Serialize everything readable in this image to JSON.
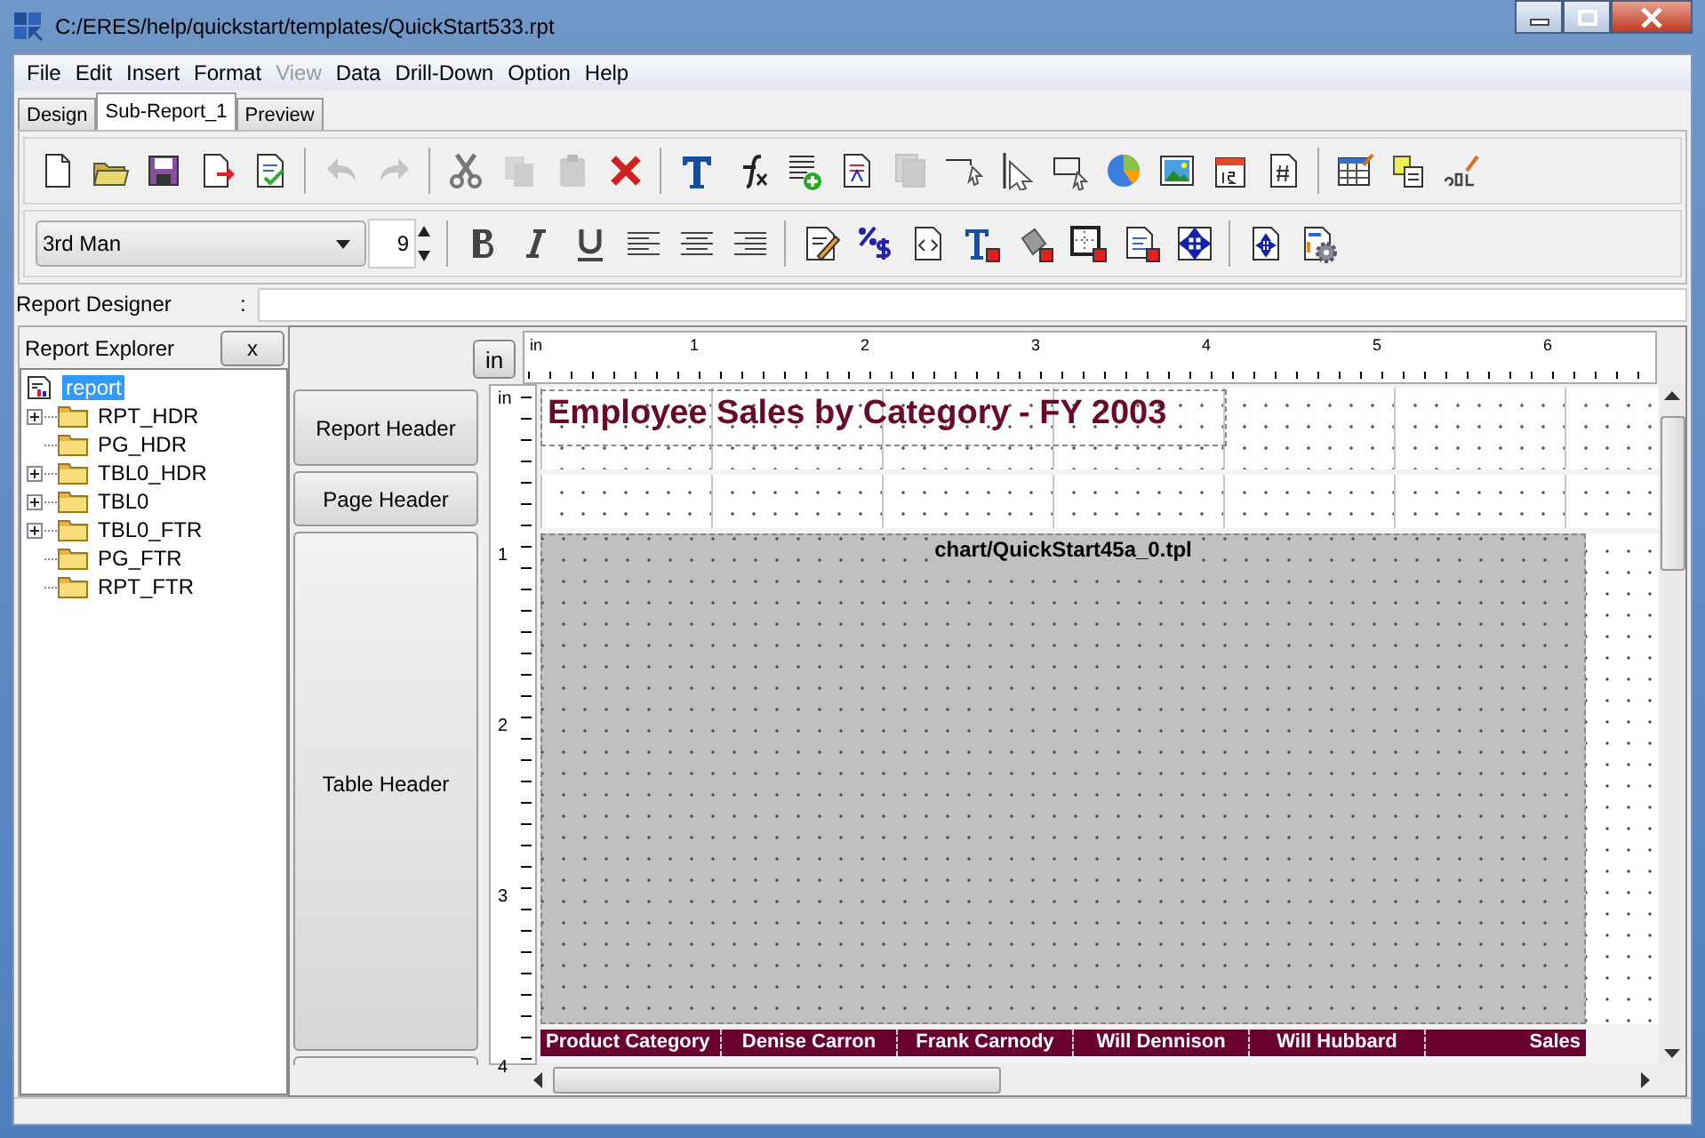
{
  "window": {
    "title": "C:/ERES/help/quickstart/templates/QuickStart533.rpt"
  },
  "menu": [
    {
      "label": "File",
      "disabled": false
    },
    {
      "label": "Edit",
      "disabled": false
    },
    {
      "label": "Insert",
      "disabled": false
    },
    {
      "label": "Format",
      "disabled": false
    },
    {
      "label": "View",
      "disabled": true
    },
    {
      "label": "Data",
      "disabled": false
    },
    {
      "label": "Drill-Down",
      "disabled": false
    },
    {
      "label": "Option",
      "disabled": false
    },
    {
      "label": "Help",
      "disabled": false
    }
  ],
  "tabs": [
    {
      "label": "Design",
      "selected": false
    },
    {
      "label": "Sub-Report_1",
      "selected": true
    },
    {
      "label": "Preview",
      "selected": false
    }
  ],
  "toolbar_1": [
    [
      {
        "kind": "new",
        "disabled": false
      },
      {
        "kind": "open",
        "disabled": false
      },
      {
        "kind": "save",
        "disabled": false
      },
      {
        "kind": "export",
        "disabled": false
      },
      {
        "kind": "validate",
        "disabled": false
      }
    ],
    [
      {
        "kind": "undo",
        "disabled": true
      },
      {
        "kind": "redo",
        "disabled": true
      }
    ],
    [
      {
        "kind": "cut",
        "disabled": false
      },
      {
        "kind": "copy",
        "disabled": true
      },
      {
        "kind": "paste",
        "disabled": true
      },
      {
        "kind": "delete",
        "disabled": false
      }
    ],
    [
      {
        "kind": "text",
        "disabled": false
      },
      {
        "kind": "formula",
        "disabled": false
      },
      {
        "kind": "add-field",
        "disabled": false
      },
      {
        "kind": "label",
        "disabled": false
      },
      {
        "kind": "subreport",
        "disabled": true
      },
      {
        "kind": "line",
        "disabled": false
      },
      {
        "kind": "vline",
        "disabled": false
      },
      {
        "kind": "rect",
        "disabled": false
      },
      {
        "kind": "chart",
        "disabled": false
      },
      {
        "kind": "image",
        "disabled": false
      },
      {
        "kind": "date",
        "disabled": false
      },
      {
        "kind": "page-number",
        "disabled": false
      }
    ],
    [
      {
        "kind": "table",
        "disabled": false
      },
      {
        "kind": "database",
        "disabled": false
      },
      {
        "kind": "sql",
        "disabled": false
      }
    ]
  ],
  "font": {
    "name": "3rd Man",
    "size": "9"
  },
  "toolbar_2": [
    [
      {
        "kind": "bold",
        "disabled": false
      },
      {
        "kind": "italic",
        "disabled": false
      },
      {
        "kind": "underline",
        "disabled": false
      },
      {
        "kind": "align-left",
        "disabled": false
      },
      {
        "kind": "align-center",
        "disabled": false
      },
      {
        "kind": "align-right",
        "disabled": false
      }
    ],
    [
      {
        "kind": "edit",
        "disabled": false
      },
      {
        "kind": "percent",
        "disabled": false
      },
      {
        "kind": "html",
        "disabled": false
      },
      {
        "kind": "text-color",
        "disabled": false
      },
      {
        "kind": "fill",
        "disabled": false
      },
      {
        "kind": "border",
        "disabled": false
      },
      {
        "kind": "doc-color",
        "disabled": false
      },
      {
        "kind": "move",
        "disabled": false
      }
    ],
    [
      {
        "kind": "fit",
        "disabled": false
      },
      {
        "kind": "settings",
        "disabled": false
      }
    ]
  ],
  "designer_field": {
    "label": "Report Designer",
    "separator": ":"
  },
  "explorer": {
    "title": "Report Explorer",
    "close": "x",
    "tree": {
      "label": "report",
      "selected": true,
      "children": [
        {
          "label": "RPT_HDR",
          "expandable": true,
          "selected": false
        },
        {
          "label": "PG_HDR",
          "expandable": false,
          "selected": false
        },
        {
          "label": "TBL0_HDR",
          "expandable": true,
          "selected": false
        },
        {
          "label": "TBL0",
          "expandable": true,
          "selected": false
        },
        {
          "label": "TBL0_FTR",
          "expandable": true,
          "selected": false
        },
        {
          "label": "PG_FTR",
          "expandable": false,
          "selected": false
        },
        {
          "label": "RPT_FTR",
          "expandable": false,
          "selected": false
        }
      ]
    }
  },
  "unit_button": "in",
  "h_ruler": [
    "in",
    "1",
    "2",
    "3",
    "4",
    "5",
    "6"
  ],
  "v_ruler": [
    "in",
    "1",
    "2",
    "3",
    "4"
  ],
  "sections": [
    {
      "label": "Report Header",
      "kind": "report-header"
    },
    {
      "label": "Page Header",
      "kind": "page-header"
    },
    {
      "label": "Table Header",
      "kind": "table-header"
    },
    {
      "kind": "cut"
    }
  ],
  "report_title": "Employee Sales by Category - FY 2003",
  "chart_template": "chart/QuickStart45a_0.tpl",
  "table_columns": [
    "Product Category",
    "Denise Carron",
    "Frank Carnody",
    "Will Dennison",
    "Will Hubbard",
    "Sales"
  ]
}
